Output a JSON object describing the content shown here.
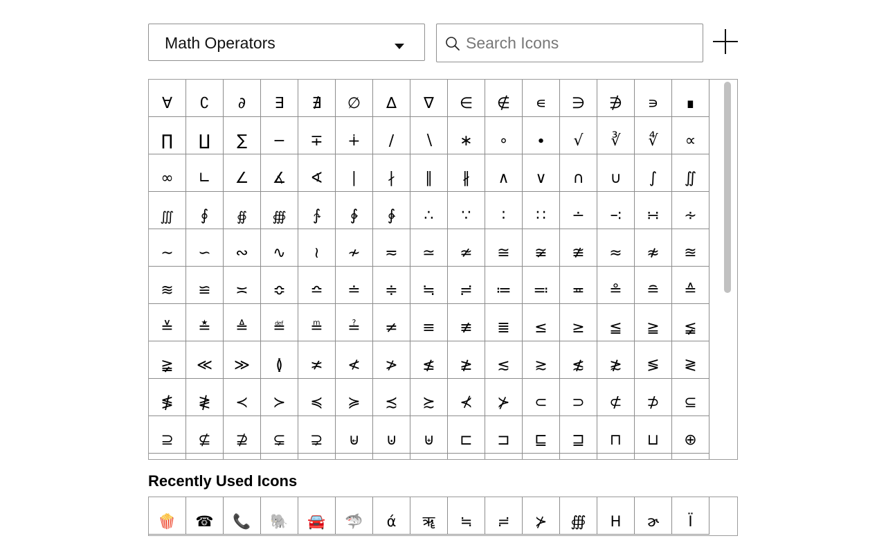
{
  "category_select": {
    "value": "Math Operators"
  },
  "search": {
    "placeholder": "Search Icons"
  },
  "add_button": {
    "label": "+"
  },
  "icons": [
    "∀",
    "∁",
    "∂",
    "∃",
    "∄",
    "∅",
    "∆",
    "∇",
    "∈",
    "∉",
    "∊",
    "∋",
    "∌",
    "∍",
    "∎",
    "∏",
    "∐",
    "∑",
    "−",
    "∓",
    "∔",
    "∕",
    "∖",
    "∗",
    "∘",
    "∙",
    "√",
    "∛",
    "∜",
    "∝",
    "∞",
    "∟",
    "∠",
    "∡",
    "∢",
    "∣",
    "∤",
    "∥",
    "∦",
    "∧",
    "∨",
    "∩",
    "∪",
    "∫",
    "∬",
    "∭",
    "∮",
    "∯",
    "∰",
    "∱",
    "∲",
    "∳",
    "∴",
    "∵",
    "∶",
    "∷",
    "∸",
    "∹",
    "∺",
    "∻",
    "∼",
    "∽",
    "∾",
    "∿",
    "≀",
    "≁",
    "≂",
    "≃",
    "≄",
    "≅",
    "≆",
    "≇",
    "≈",
    "≉",
    "≊",
    "≋",
    "≌",
    "≍",
    "≎",
    "≏",
    "≐",
    "≑",
    "≒",
    "≓",
    "≔",
    "≕",
    "≖",
    "≗",
    "≘",
    "≙",
    "≚",
    "≛",
    "≜",
    "≝",
    "≞",
    "≟",
    "≠",
    "≡",
    "≢",
    "≣",
    "≤",
    "≥",
    "≦",
    "≧",
    "≨",
    "≩",
    "≪",
    "≫",
    "≬",
    "≭",
    "≮",
    "≯",
    "≰",
    "≱",
    "≲",
    "≳",
    "≴",
    "≵",
    "≶",
    "≷",
    "≸",
    "≹",
    "≺",
    "≻",
    "≼",
    "≽",
    "≾",
    "≿",
    "⊀",
    "⊁",
    "⊂",
    "⊃",
    "⊄",
    "⊅",
    "⊆",
    "⊇",
    "⊈",
    "⊉",
    "⊊",
    "⊋",
    "⊌",
    "⊍",
    "⊎",
    "⊏",
    "⊐",
    "⊑",
    "⊒",
    "⊓",
    "⊔",
    "⊕",
    "⊖",
    "⊗",
    "⊘",
    "⊙",
    "⊚",
    "⊛",
    "⊜",
    "⊝",
    "⊞",
    "⊟",
    "⊠",
    "⊡",
    "⊢",
    "⊣",
    "⊤"
  ],
  "recent": {
    "heading": "Recently Used Icons",
    "icons": [
      "🍿",
      "☎",
      "📞",
      "🐘",
      "🚘",
      "🦈",
      "ά",
      "ॠ",
      "≒",
      "≓",
      "⊁",
      "∰",
      "Η",
      "ɚ",
      "Ï"
    ]
  },
  "colors": {
    "border": "#8c8c8c",
    "scroll_thumb": "#c1c1c1"
  }
}
